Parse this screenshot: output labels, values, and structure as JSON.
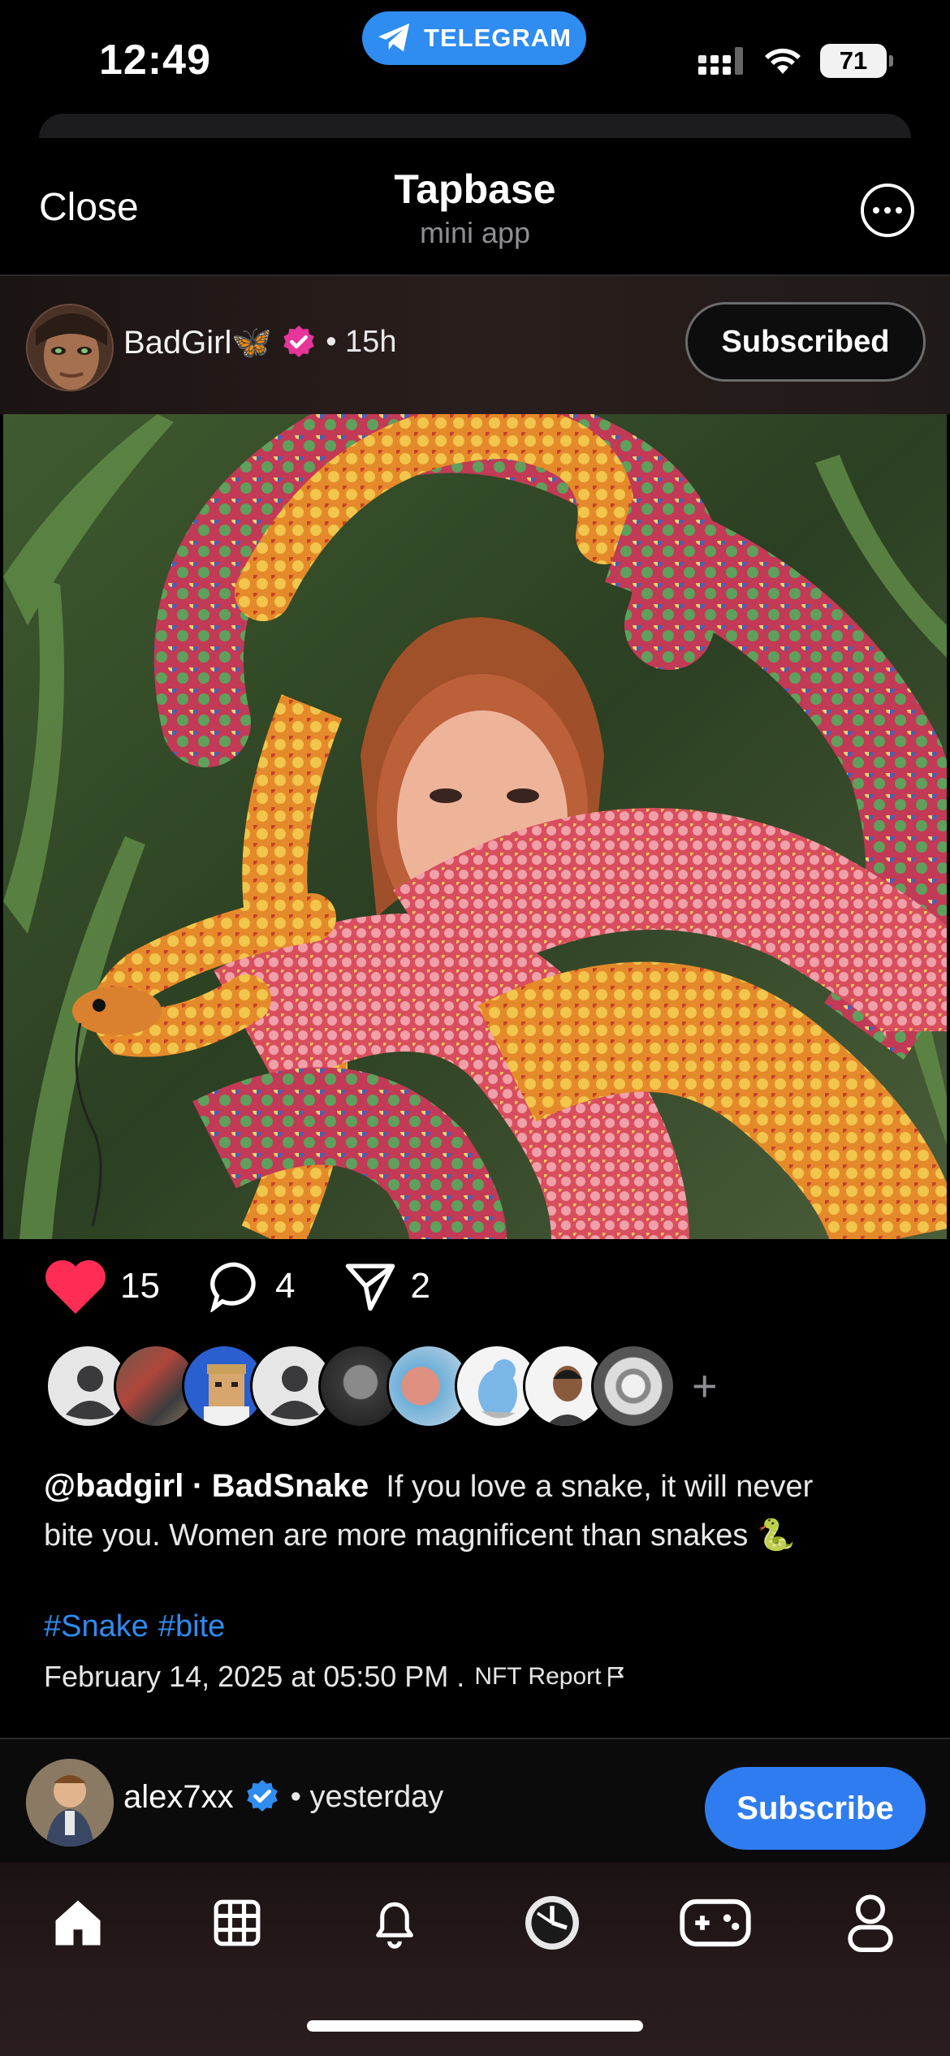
{
  "status_bar": {
    "time": "12:49",
    "telegram_label": "TELEGRAM",
    "battery": "71"
  },
  "header": {
    "close_label": "Close",
    "title": "Tapbase",
    "subtitle": "mini app"
  },
  "post": {
    "author": "BadGirl🦋",
    "time_ago": "• 15h",
    "subscribe_label": "Subscribed",
    "likes": "15",
    "comments": "4",
    "shares": "2",
    "handle": "@badgirl",
    "separator": "·",
    "post_title": "BadSnake",
    "caption": "If you love a snake, it will never bite you. Women are more magnificent than snakes 🐍",
    "hashtags": [
      "#Snake",
      "#bite"
    ],
    "date": "February 14, 2025 at 05:50 PM .",
    "nft_report": "NFT Report"
  },
  "liked_avatars_plus": "+",
  "next_post": {
    "author": "alex7xx",
    "time_ago": "• yesterday",
    "subscribe_label": "Subscribe"
  },
  "tabs": [
    "home-icon",
    "grid-icon",
    "bell-icon",
    "clock-icon",
    "gamepad-icon",
    "profile-icon"
  ],
  "colors": {
    "accent": "#2f8cf0",
    "like": "#ff2d55",
    "verified_pink": "#e6359b",
    "verified_blue": "#2f8cf0"
  }
}
